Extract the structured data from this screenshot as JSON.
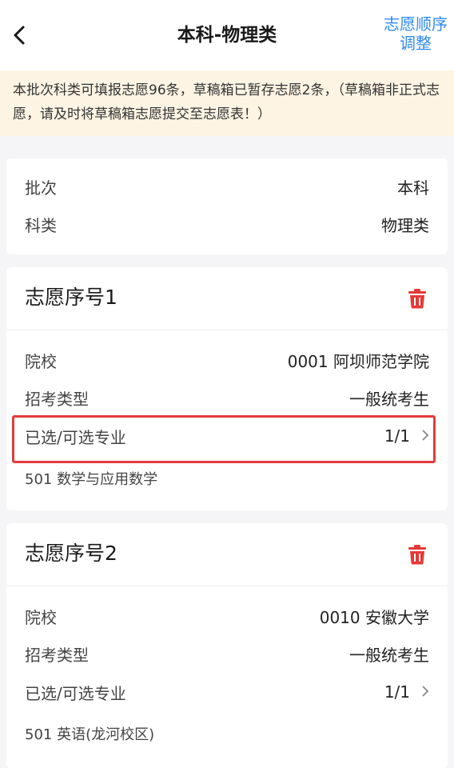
{
  "header": {
    "title": "本科-物理类",
    "order_btn_line1": "志愿顺序",
    "order_btn_line2": "调整"
  },
  "notice": {
    "text": "本批次科类可填报志愿96条，草稿箱已暂存志愿2条，（草稿箱非正式志愿，请及时将草稿箱志愿提交至志愿表！）"
  },
  "info": {
    "batch_label": "批次",
    "batch_value": "本科",
    "category_label": "科类",
    "category_value": "物理类"
  },
  "choices": [
    {
      "title": "志愿序号1",
      "school_label": "院校",
      "school_value": "0001 阿坝师范学院",
      "type_label": "招考类型",
      "type_value": "一般统考生",
      "major_label": "已选/可选专业",
      "major_value": "1/1",
      "major_text": "501 数学与应用数学"
    },
    {
      "title": "志愿序号2",
      "school_label": "院校",
      "school_value": "0010 安徽大学",
      "type_label": "招考类型",
      "type_value": "一般统考生",
      "major_label": "已选/可选专业",
      "major_value": "1/1",
      "major_text": "501 英语(龙河校区)"
    }
  ],
  "icons": {
    "back": "chevron-left-icon",
    "trash": "trash-icon",
    "chevron": "chevron-right-icon"
  },
  "colors": {
    "accent": "#2f8bf0",
    "delete": "#e53935",
    "highlight": "#e23b3b",
    "notice_bg": "#fdf4e3"
  }
}
